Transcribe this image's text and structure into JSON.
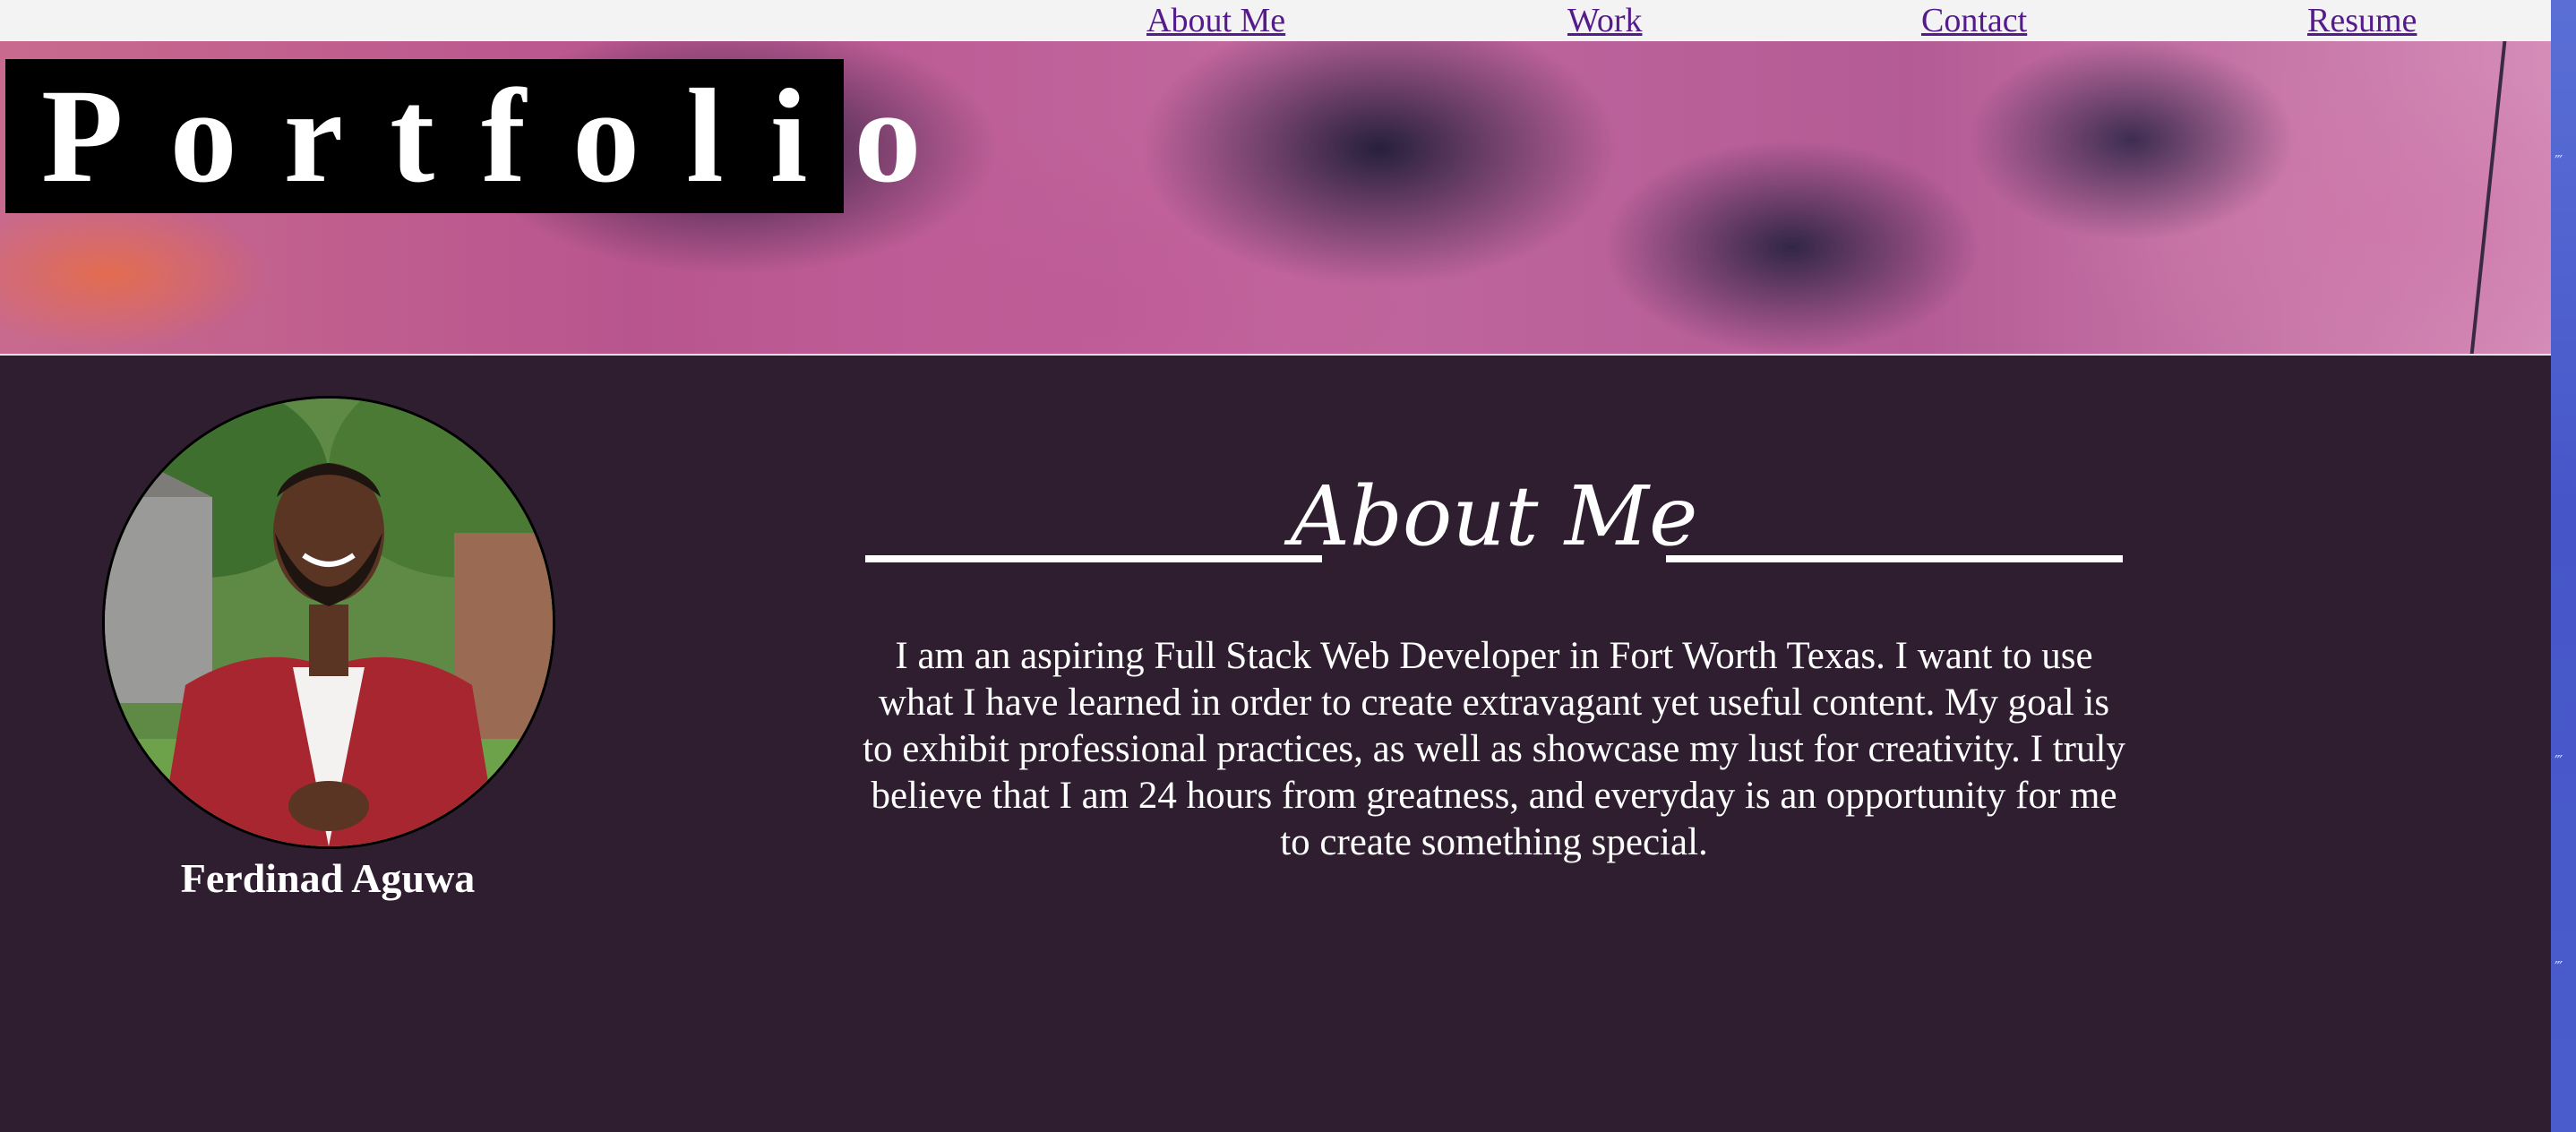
{
  "nav": {
    "about": "About Me",
    "work": "Work",
    "contact": "Contact",
    "resume": "Resume"
  },
  "hero": {
    "brand": "Portfolio"
  },
  "profile": {
    "name": "Ferdinad Aguwa"
  },
  "about": {
    "heading": "About Me",
    "body": "I am an aspiring Full Stack Web Developer in Fort Worth Texas. I want to use what I have learned in order to create extravagant yet useful content. My goal is to exhibit professional practices, as well as showcase my lust for creativity. I truly believe that I am 24 hours from greatness, and everyday is an opportunity for me to create something special."
  },
  "colors": {
    "page_background": "#2f1e2f",
    "nav_background": "#f3f3f3",
    "link": "#551a8b",
    "text": "#ffffff",
    "brand_box": "#000000"
  }
}
